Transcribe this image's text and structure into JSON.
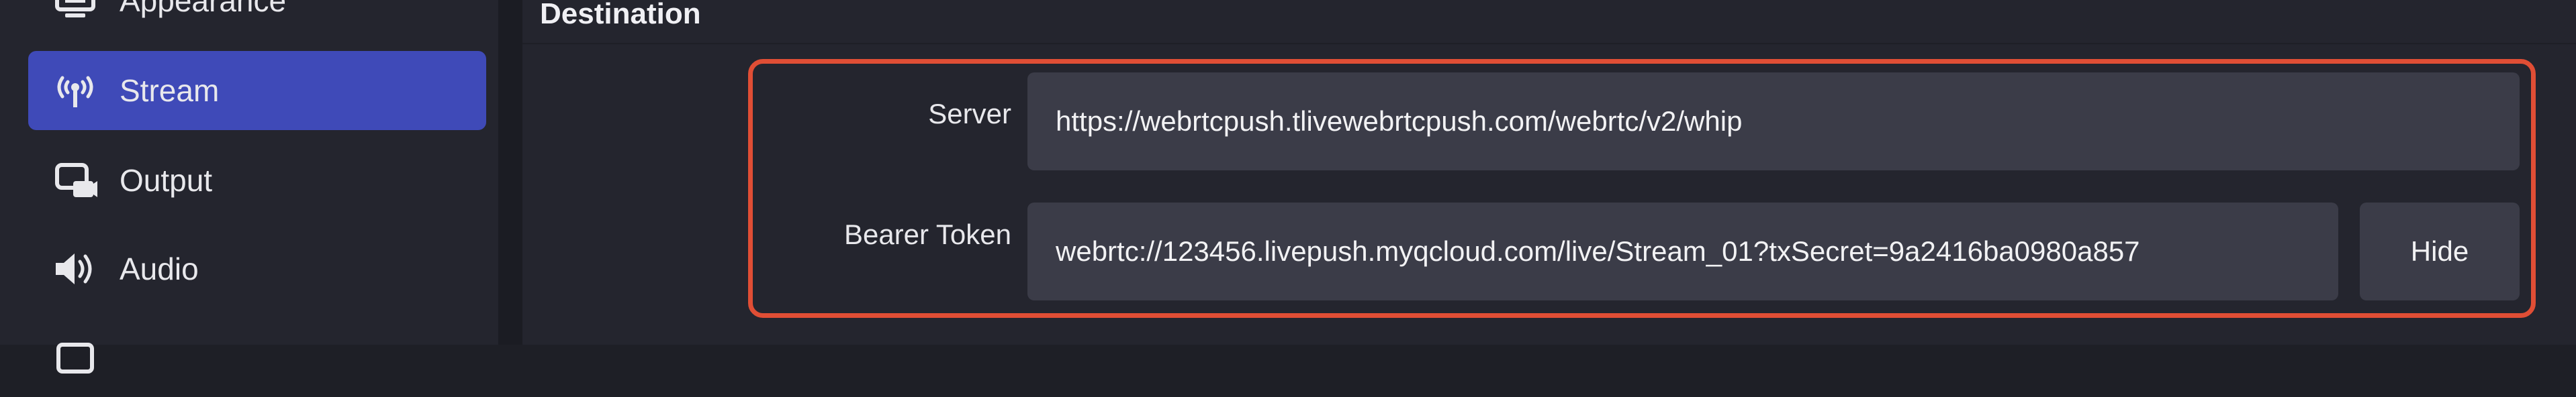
{
  "sidebar": {
    "items": [
      {
        "label": "Appearance",
        "icon": "monitor-icon",
        "active": false
      },
      {
        "label": "Stream",
        "icon": "antenna-icon",
        "active": true
      },
      {
        "label": "Output",
        "icon": "output-icon",
        "active": false
      },
      {
        "label": "Audio",
        "icon": "speaker-icon",
        "active": false
      },
      {
        "label": "",
        "icon": "video-icon",
        "active": false
      }
    ]
  },
  "destination": {
    "title": "Destination",
    "server_label": "Server",
    "server_value": "https://webrtcpush.tlivewebrtcpush.com/webrtc/v2/whip",
    "token_label": "Bearer Token",
    "token_value": "webrtc://123456.livepush.myqcloud.com/live/Stream_01?txSecret=9a2416ba0980a857",
    "hide_label": "Hide"
  },
  "colors": {
    "accent": "#3f4ab8",
    "highlight": "#e04e35",
    "field_bg": "#3b3c48",
    "panel_bg": "#24252e"
  }
}
